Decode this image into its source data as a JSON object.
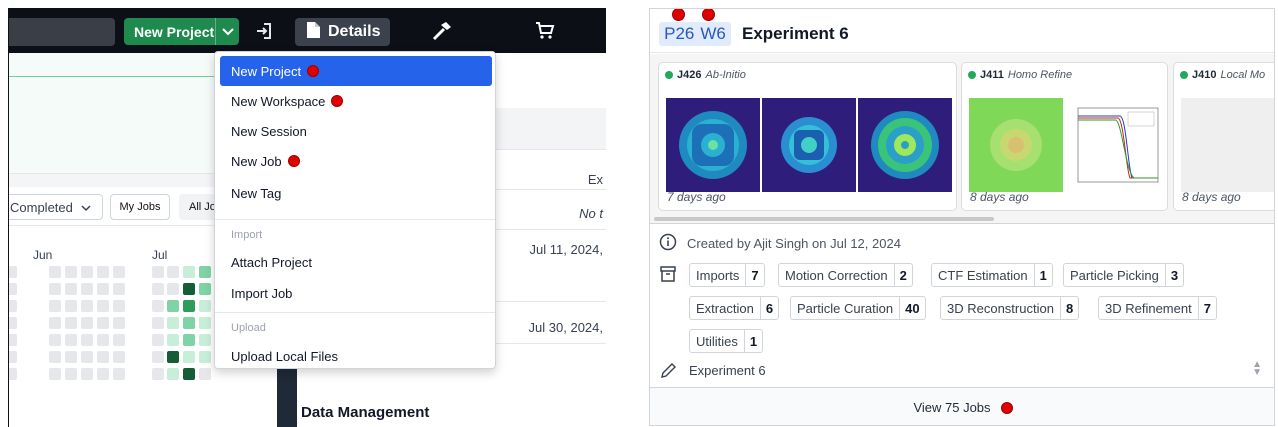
{
  "topbar": {
    "new_project_label": "New Project",
    "details_label": "Details",
    "icons": [
      "chevron-down-icon",
      "sign-in-icon",
      "file-icon",
      "hammer-icon",
      "cart-icon"
    ]
  },
  "menu": {
    "items": [
      {
        "label": "New Project",
        "active": true,
        "marked": true
      },
      {
        "label": "New Workspace",
        "marked": true
      },
      {
        "label": "New Session"
      },
      {
        "label": "New Job",
        "marked": true
      },
      {
        "label": "New Tag"
      }
    ],
    "import_section": "Import",
    "import_items": [
      "Attach Project",
      "Import Job"
    ],
    "upload_section": "Upload",
    "upload_items": [
      "Upload Local Files"
    ]
  },
  "jobs_filter": {
    "status_value": "Completed",
    "my_jobs_label": "My Jobs",
    "all_jobs_label": "All Jo"
  },
  "activity": {
    "months": [
      "Jun",
      "Jul"
    ]
  },
  "mid_panel": {
    "col_header": "Ex",
    "empty_text": "No t",
    "row1_date": "Jul 11, 2024,",
    "row2_date": "Jul 30, 2024,",
    "section_title": "Data Management"
  },
  "project": {
    "project_id": "P26",
    "workspace_id": "W6",
    "title": "Experiment 6",
    "jobs": [
      {
        "id": "J426",
        "type": "Ab-Initio",
        "ago": "7 days ago"
      },
      {
        "id": "J411",
        "type": "Homo Refine",
        "ago": "8 days ago"
      },
      {
        "id": "J410",
        "type": "Local Mo",
        "ago": "8 days ago"
      }
    ],
    "created_text": "Created by Ajit Singh on Jul 12, 2024",
    "categories": [
      {
        "label": "Imports",
        "count": "7"
      },
      {
        "label": "Motion Correction",
        "count": "2"
      },
      {
        "label": "CTF Estimation",
        "count": "1"
      },
      {
        "label": "Particle Picking",
        "count": "3"
      },
      {
        "label": "Extraction",
        "count": "6"
      },
      {
        "label": "Particle Curation",
        "count": "40"
      },
      {
        "label": "3D Reconstruction",
        "count": "8"
      },
      {
        "label": "3D Refinement",
        "count": "7"
      },
      {
        "label": "Utilities",
        "count": "1"
      }
    ],
    "description": "Experiment 6",
    "view_jobs_label": "View 75 Jobs"
  },
  "colors": {
    "accent_blue": "#2563eb",
    "brand_green": "#1f8a4d",
    "status_green": "#22a95b",
    "marker_red": "#e00000",
    "heatmap_levels": [
      "#e5e7eb",
      "#c6eed8",
      "#7fd3a4",
      "#2f9c5c",
      "#155d36"
    ]
  }
}
